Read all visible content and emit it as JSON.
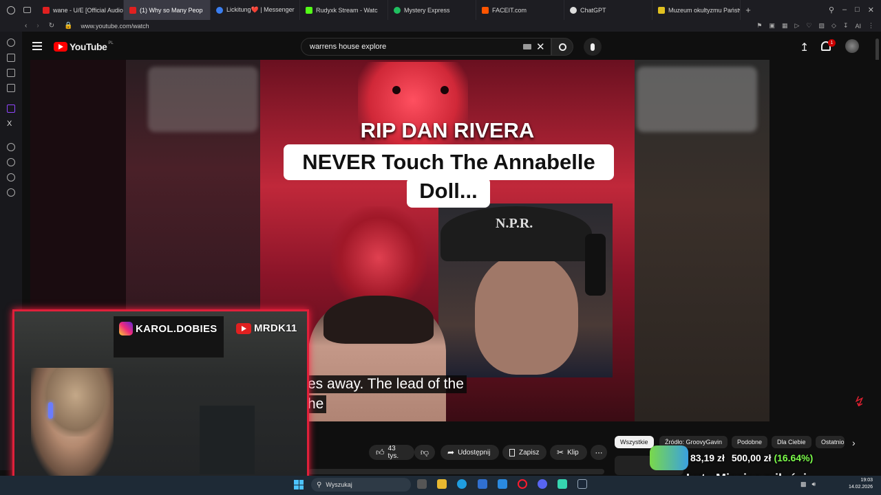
{
  "browser": {
    "tabs": [
      {
        "label": "wane - U/E [Official Audio]",
        "color": "#e02020"
      },
      {
        "label": "(1) Why so Many Peop",
        "color": "#e02020",
        "active": true
      },
      {
        "label": "Lickitung❤️ | Messenger",
        "color": "#3a7ef0"
      },
      {
        "label": "Rudyxk Stream - Watc",
        "color": "#53fc18"
      },
      {
        "label": "Mystery Express",
        "color": "#20c060"
      },
      {
        "label": "FACEIT.com",
        "color": "#ff5500"
      },
      {
        "label": "ChatGPT",
        "color": "#dddddd"
      },
      {
        "label": "Muzeum okultyzmu Państw",
        "color": "#e0c020"
      }
    ],
    "url": "www.youtube.com/watch",
    "ai_label": "AI"
  },
  "youtube": {
    "logo_text": "YouTube",
    "region": "PL",
    "search_value": "warrens house explore",
    "notification_count": "1"
  },
  "video": {
    "headline": "RIP DAN RIVERA",
    "title_line1": "NEVER Touch The Annabelle",
    "title_line2": "Doll...",
    "cap_text": "N.P.R.",
    "caption_line1": "es away. The lead of the",
    "caption_line2": "he"
  },
  "actions": {
    "likes": "43 tys.",
    "share": "Udostępnij",
    "save": "Zapisz",
    "clip": "Klip"
  },
  "chips": [
    "Wszystkie",
    "Źródło: GroovyGavin",
    "Podobne",
    "Dla Ciebie",
    "Ostatnio"
  ],
  "overlay": {
    "instagram": "KAROL.DOBIES",
    "youtube": "MRDK11",
    "goal_current": "83,19 zł",
    "goal_target": "500,00 zł",
    "goal_pct": "(16.64%)",
    "goal_fraction": 0.1664,
    "event_title": "Luty Miesiąc miłości"
  },
  "taskbar": {
    "search_placeholder": "Wyszukaj",
    "time": "19:03",
    "date": "14.02.2026"
  }
}
